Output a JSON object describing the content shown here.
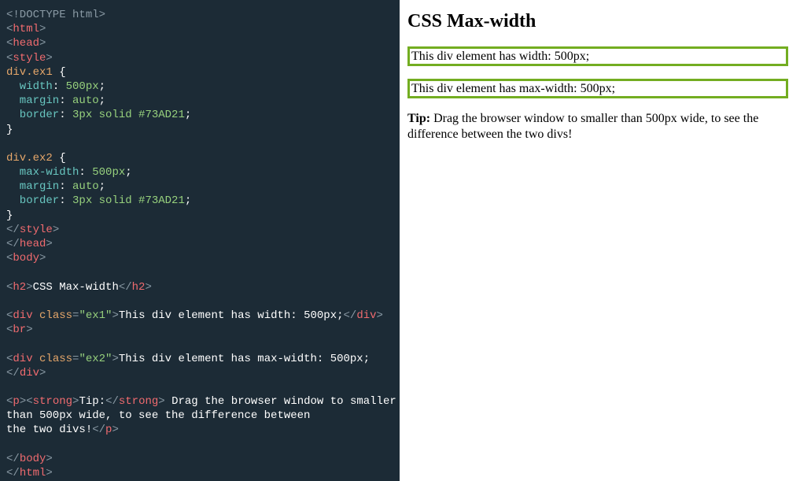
{
  "code": {
    "lines": [
      [
        {
          "t": "<!DOCTYPE html>",
          "c": "c-gray"
        }
      ],
      [
        {
          "t": "<",
          "c": "c-gray"
        },
        {
          "t": "html",
          "c": "c-red"
        },
        {
          "t": ">",
          "c": "c-gray"
        }
      ],
      [
        {
          "t": "<",
          "c": "c-gray"
        },
        {
          "t": "head",
          "c": "c-red"
        },
        {
          "t": ">",
          "c": "c-gray"
        }
      ],
      [
        {
          "t": "<",
          "c": "c-gray"
        },
        {
          "t": "style",
          "c": "c-red"
        },
        {
          "t": ">",
          "c": "c-gray"
        }
      ],
      [
        {
          "t": "div.ex1 ",
          "c": "c-orange"
        },
        {
          "t": "{",
          "c": "c-white"
        }
      ],
      [
        {
          "t": "  width",
          "c": "c-cyan"
        },
        {
          "t": ": ",
          "c": "c-white"
        },
        {
          "t": "500px",
          "c": "c-green"
        },
        {
          "t": ";",
          "c": "c-white"
        }
      ],
      [
        {
          "t": "  margin",
          "c": "c-cyan"
        },
        {
          "t": ": ",
          "c": "c-white"
        },
        {
          "t": "auto",
          "c": "c-green"
        },
        {
          "t": ";",
          "c": "c-white"
        }
      ],
      [
        {
          "t": "  border",
          "c": "c-cyan"
        },
        {
          "t": ": ",
          "c": "c-white"
        },
        {
          "t": "3px solid #73AD21",
          "c": "c-green"
        },
        {
          "t": ";",
          "c": "c-white"
        }
      ],
      [
        {
          "t": "}",
          "c": "c-white"
        }
      ],
      [
        {
          "t": "",
          "c": "c-white"
        }
      ],
      [
        {
          "t": "div.ex2 ",
          "c": "c-orange"
        },
        {
          "t": "{",
          "c": "c-white"
        }
      ],
      [
        {
          "t": "  max-width",
          "c": "c-cyan"
        },
        {
          "t": ": ",
          "c": "c-white"
        },
        {
          "t": "500px",
          "c": "c-green"
        },
        {
          "t": ";",
          "c": "c-white"
        }
      ],
      [
        {
          "t": "  margin",
          "c": "c-cyan"
        },
        {
          "t": ": ",
          "c": "c-white"
        },
        {
          "t": "auto",
          "c": "c-green"
        },
        {
          "t": ";",
          "c": "c-white"
        }
      ],
      [
        {
          "t": "  border",
          "c": "c-cyan"
        },
        {
          "t": ": ",
          "c": "c-white"
        },
        {
          "t": "3px solid #73AD21",
          "c": "c-green"
        },
        {
          "t": ";",
          "c": "c-white"
        }
      ],
      [
        {
          "t": "}",
          "c": "c-white"
        }
      ],
      [
        {
          "t": "</",
          "c": "c-gray"
        },
        {
          "t": "style",
          "c": "c-red"
        },
        {
          "t": ">",
          "c": "c-gray"
        }
      ],
      [
        {
          "t": "</",
          "c": "c-gray"
        },
        {
          "t": "head",
          "c": "c-red"
        },
        {
          "t": ">",
          "c": "c-gray"
        }
      ],
      [
        {
          "t": "<",
          "c": "c-gray"
        },
        {
          "t": "body",
          "c": "c-red"
        },
        {
          "t": ">",
          "c": "c-gray"
        }
      ],
      [
        {
          "t": "",
          "c": "c-white"
        }
      ],
      [
        {
          "t": "<",
          "c": "c-gray"
        },
        {
          "t": "h2",
          "c": "c-red"
        },
        {
          "t": ">",
          "c": "c-gray"
        },
        {
          "t": "CSS Max-width",
          "c": "c-white"
        },
        {
          "t": "</",
          "c": "c-gray"
        },
        {
          "t": "h2",
          "c": "c-red"
        },
        {
          "t": ">",
          "c": "c-gray"
        }
      ],
      [
        {
          "t": "",
          "c": "c-white"
        }
      ],
      [
        {
          "t": "<",
          "c": "c-gray"
        },
        {
          "t": "div ",
          "c": "c-red"
        },
        {
          "t": "class",
          "c": "c-orange"
        },
        {
          "t": "=",
          "c": "c-gray"
        },
        {
          "t": "\"ex1\"",
          "c": "c-green"
        },
        {
          "t": ">",
          "c": "c-gray"
        },
        {
          "t": "This div element has width: 500px;",
          "c": "c-white"
        },
        {
          "t": "</",
          "c": "c-gray"
        },
        {
          "t": "div",
          "c": "c-red"
        },
        {
          "t": ">",
          "c": "c-gray"
        }
      ],
      [
        {
          "t": "<",
          "c": "c-gray"
        },
        {
          "t": "br",
          "c": "c-red"
        },
        {
          "t": ">",
          "c": "c-gray"
        }
      ],
      [
        {
          "t": "",
          "c": "c-white"
        }
      ],
      [
        {
          "t": "<",
          "c": "c-gray"
        },
        {
          "t": "div ",
          "c": "c-red"
        },
        {
          "t": "class",
          "c": "c-orange"
        },
        {
          "t": "=",
          "c": "c-gray"
        },
        {
          "t": "\"ex2\"",
          "c": "c-green"
        },
        {
          "t": ">",
          "c": "c-gray"
        },
        {
          "t": "This div element has max-width: 500px;",
          "c": "c-white"
        }
      ],
      [
        {
          "t": "</",
          "c": "c-gray"
        },
        {
          "t": "div",
          "c": "c-red"
        },
        {
          "t": ">",
          "c": "c-gray"
        }
      ],
      [
        {
          "t": "",
          "c": "c-white"
        }
      ],
      [
        {
          "t": "<",
          "c": "c-gray"
        },
        {
          "t": "p",
          "c": "c-red"
        },
        {
          "t": ">",
          "c": "c-gray"
        },
        {
          "t": "<",
          "c": "c-gray"
        },
        {
          "t": "strong",
          "c": "c-red"
        },
        {
          "t": ">",
          "c": "c-gray"
        },
        {
          "t": "Tip:",
          "c": "c-white"
        },
        {
          "t": "</",
          "c": "c-gray"
        },
        {
          "t": "strong",
          "c": "c-red"
        },
        {
          "t": ">",
          "c": "c-gray"
        },
        {
          "t": " Drag the browser window to smaller ",
          "c": "c-white"
        }
      ],
      [
        {
          "t": "than 500px wide, to see the difference between ",
          "c": "c-white"
        }
      ],
      [
        {
          "t": "the two divs!",
          "c": "c-white"
        },
        {
          "t": "</",
          "c": "c-gray"
        },
        {
          "t": "p",
          "c": "c-red"
        },
        {
          "t": ">",
          "c": "c-gray"
        }
      ],
      [
        {
          "t": "",
          "c": "c-white"
        }
      ],
      [
        {
          "t": "</",
          "c": "c-gray"
        },
        {
          "t": "body",
          "c": "c-red"
        },
        {
          "t": ">",
          "c": "c-gray"
        }
      ],
      [
        {
          "t": "</",
          "c": "c-gray"
        },
        {
          "t": "html",
          "c": "c-red"
        },
        {
          "t": ">",
          "c": "c-gray"
        }
      ]
    ]
  },
  "preview": {
    "heading": "CSS Max-width",
    "box1_text": "This div element has width: 500px;",
    "box2_text": "This div element has max-width: 500px;",
    "tip_label": "Tip:",
    "tip_text": " Drag the browser window to smaller than 500px wide, to see the difference between the two divs!"
  }
}
